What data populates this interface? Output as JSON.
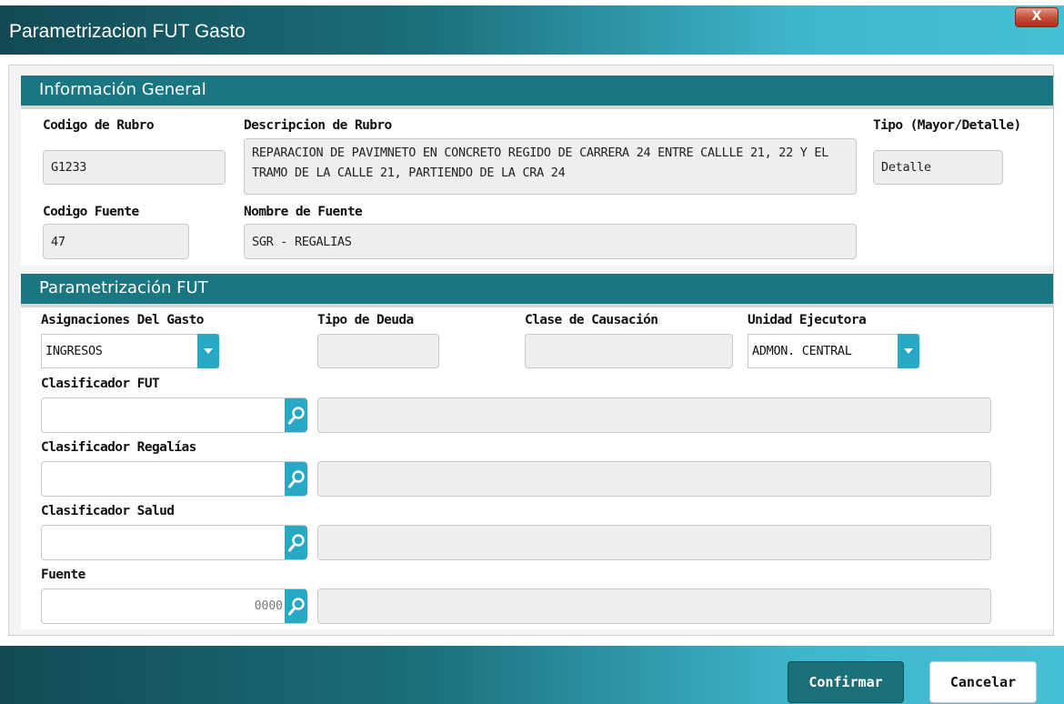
{
  "window": {
    "title": "Parametrizacion FUT Gasto",
    "close_label": "X"
  },
  "general": {
    "header": "Información General",
    "codigo_rubro": {
      "label": "Codigo de Rubro",
      "value": "G1233"
    },
    "descripcion_rubro": {
      "label": "Descripcion de Rubro",
      "value": "REPARACION DE PAVIMNETO EN CONCRETO REGIDO DE CARRERA 24 ENTRE CALLLE 21, 22 Y EL TRAMO DE LA CALLE 21, PARTIENDO DE LA CRA 24"
    },
    "tipo": {
      "label": "Tipo (Mayor/Detalle)",
      "value": "Detalle"
    },
    "codigo_fuente": {
      "label": "Codigo Fuente",
      "value": "47"
    },
    "nombre_fuente": {
      "label": "Nombre de Fuente",
      "value": "SGR - REGALIAS"
    }
  },
  "fut": {
    "header": "Parametrización FUT",
    "asignaciones": {
      "label": "Asignaciones Del Gasto",
      "value": "INGRESOS"
    },
    "tipo_deuda": {
      "label": "Tipo de Deuda",
      "value": ""
    },
    "clase_causacion": {
      "label": "Clase de Causación",
      "value": ""
    },
    "unidad_ejecutora": {
      "label": "Unidad Ejecutora",
      "value": "ADMON. CENTRAL"
    },
    "clasificador_fut": {
      "label": "Clasificador FUT",
      "value": "",
      "description": ""
    },
    "clasificador_regalias": {
      "label": "Clasificador Regalías",
      "value": "",
      "description": ""
    },
    "clasificador_salud": {
      "label": "Clasificador Salud",
      "value": "",
      "description": ""
    },
    "fuente": {
      "label": "Fuente",
      "value": "0000",
      "description": ""
    }
  },
  "footer": {
    "confirm_label": "Confirmar",
    "cancel_label": "Cancelar"
  },
  "colors": {
    "header_teal": "#1a7680",
    "accent_blue": "#27a9c6",
    "close_red": "#c24a36"
  },
  "icons": {
    "search": "search-icon",
    "dropdown": "chevron-down-icon",
    "close": "close-icon"
  }
}
